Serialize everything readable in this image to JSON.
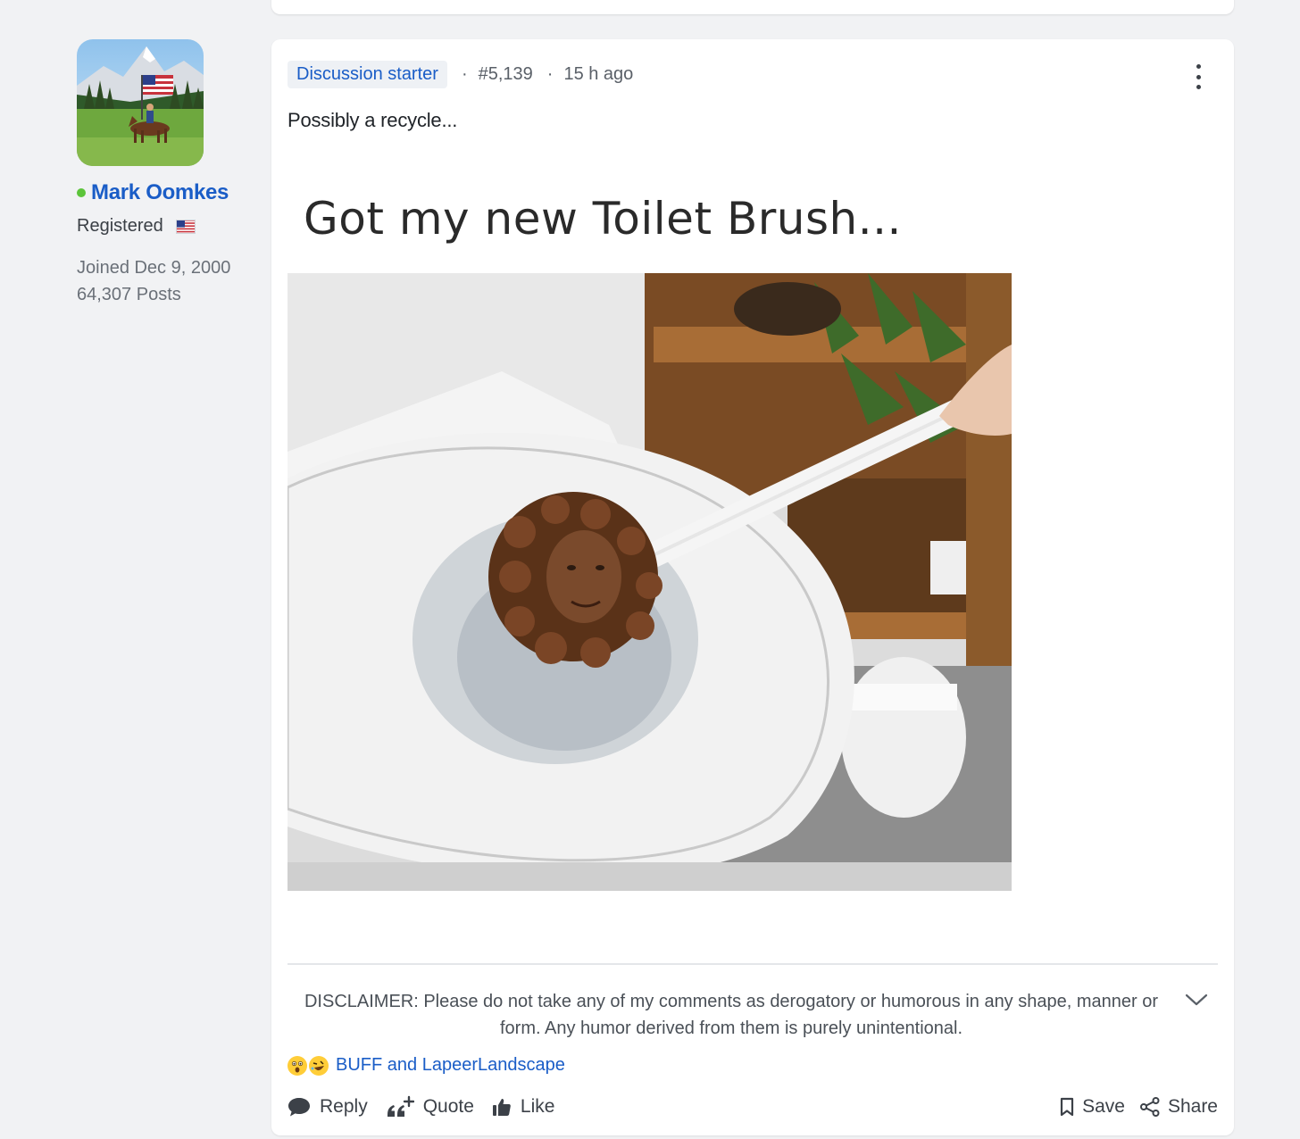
{
  "author": {
    "name": "Mark Oomkes",
    "role": "Registered",
    "joined": "Joined Dec 9, 2000",
    "posts": "64,307 Posts",
    "online": true
  },
  "post": {
    "badge": "Discussion starter",
    "separator": "·",
    "number": "#5,139",
    "time": "15 h ago",
    "text": "Possibly a recycle...",
    "image_caption": "Got my new Toilet Brush...",
    "disclaimer": "DISCLAIMER: Please do not take any of my comments as derogatory or humorous in any shape, manner or form. Any humor derived from them is purely unintentional.",
    "reactions": {
      "icons": [
        "astonished-face-icon",
        "rofl-face-icon"
      ],
      "users": "BUFF and LapeerLandscape"
    }
  },
  "actions": {
    "reply": "Reply",
    "quote": "Quote",
    "like": "Like",
    "save": "Save",
    "share": "Share"
  },
  "colors": {
    "link": "#1a5dc7",
    "online": "#5cc43a",
    "page_bg": "#f1f2f4",
    "badge_bg": "#eef1f5"
  }
}
